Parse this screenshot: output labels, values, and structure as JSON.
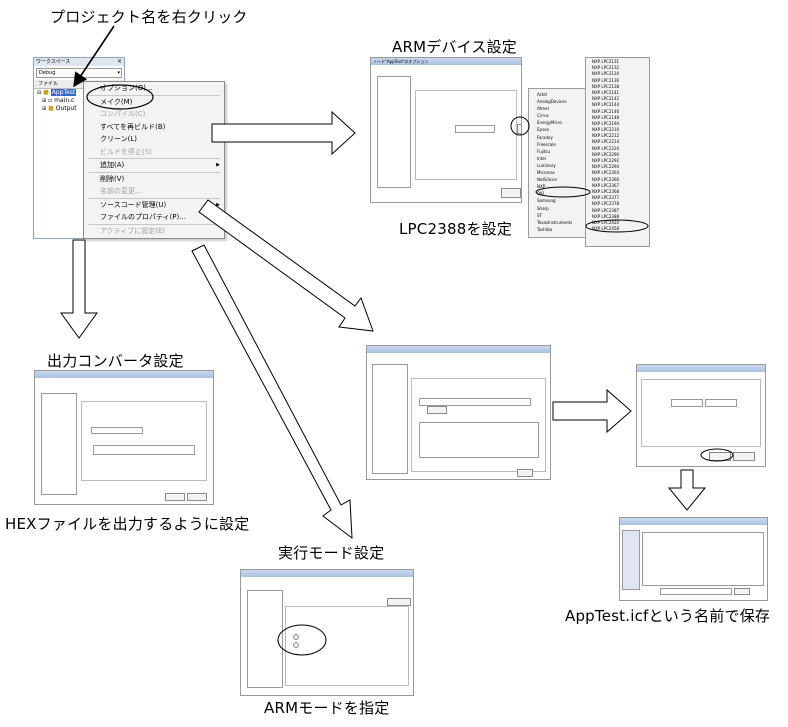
{
  "captions": {
    "right_click": "プロジェクト名を右クリック",
    "arm_device": "ARMデバイス設定",
    "lpc": "LPC2388を設定",
    "output_converter": "出力コンバータ設定",
    "hex": "HEXファイルを出力するように設定",
    "exec_mode": "実行モード設定",
    "arm_mode": "ARMモードを指定",
    "save": "AppTest.icfという名前で保存"
  },
  "workspace": {
    "title": "ワークスペース",
    "config": "Debug",
    "col_file": "ファイル",
    "tree": [
      "AppTest",
      "main.c",
      "Output"
    ]
  },
  "context_menu": {
    "items": [
      {
        "label": "オプション(O)...",
        "disabled": false,
        "submenu": false
      },
      {
        "label": "メイク(M)",
        "disabled": false,
        "submenu": false
      },
      {
        "label": "コンパイル(C)",
        "disabled": true,
        "submenu": false
      },
      {
        "label": "すべてを再ビルド(B)",
        "disabled": false,
        "submenu": false
      },
      {
        "label": "クリーン(L)",
        "disabled": false,
        "submenu": false
      },
      {
        "label": "ビルドを停止(S)",
        "disabled": true,
        "submenu": false
      },
      {
        "label": "追加(A)",
        "disabled": false,
        "submenu": true
      },
      {
        "label": "削除(V)",
        "disabled": false,
        "submenu": false
      },
      {
        "label": "名前の変更...",
        "disabled": true,
        "submenu": false
      },
      {
        "label": "ソースコード管理(U)",
        "disabled": false,
        "submenu": true
      },
      {
        "label": "ファイルのプロパティ(P)...",
        "disabled": false,
        "submenu": false
      },
      {
        "label": "アクティブに設定(E)",
        "disabled": true,
        "submenu": false
      }
    ]
  },
  "arm_dialog": {
    "title": "ノード\"AppTest\"のオプション",
    "vendors": [
      "Actel",
      "AnalogDevices",
      "Atmel",
      "Cirrus",
      "EnergyMicro",
      "Epson",
      "Faraday",
      "Freescale",
      "Fujitsu",
      "Intel",
      "Luminary",
      "Micronas",
      "NetSilicon",
      "NXP",
      "OKI",
      "Samsung",
      "Sharp",
      "ST",
      "TexasInstruments",
      "Toshiba"
    ],
    "nxp_parts": [
      "NXP LPC2131",
      "NXP LPC2132",
      "NXP LPC2134",
      "NXP LPC2136",
      "NXP LPC2138",
      "NXP LPC2141",
      "NXP LPC2142",
      "NXP LPC2144",
      "NXP LPC2146",
      "NXP LPC2148",
      "NXP LPC2194",
      "NXP LPC2210",
      "NXP LPC2212",
      "NXP LPC2214",
      "NXP LPC2220",
      "NXP LPC2290",
      "NXP LPC2292",
      "NXP LPC2294",
      "NXP LPC2364",
      "NXP LPC2366",
      "NXP LPC2367",
      "NXP LPC2368",
      "NXP LPC2377",
      "NXP LPC2378",
      "NXP LPC2387",
      "NXP LPC2388",
      "NXP LPC2420",
      "NXP LPC2458"
    ]
  },
  "colors": {
    "ellipse": "#000000",
    "arrow_fill": "#ffffff",
    "window_title": "#b8cce6"
  }
}
